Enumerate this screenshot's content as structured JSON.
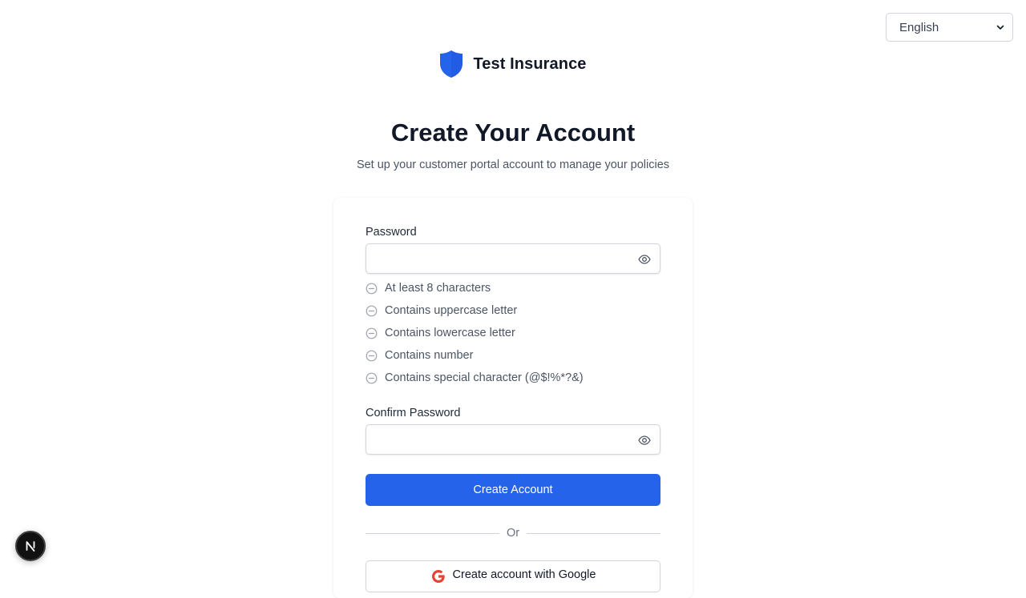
{
  "language_select": {
    "value": "English"
  },
  "brand": {
    "name": "Test Insurance",
    "color": "#2563eb"
  },
  "header": {
    "title": "Create Your Account",
    "subtitle": "Set up your customer portal account to manage your policies"
  },
  "form": {
    "password_label": "Password",
    "password_value": "",
    "requirements": [
      "At least 8 characters",
      "Contains uppercase letter",
      "Contains lowercase letter",
      "Contains number",
      "Contains special character (@$!%*?&)"
    ],
    "confirm_label": "Confirm Password",
    "confirm_value": "",
    "submit_label": "Create Account",
    "divider_text": "Or",
    "google_label": "Create account with Google"
  },
  "colors": {
    "primary": "#2563eb",
    "text": "#111827",
    "muted": "#4b5563"
  },
  "icons": {
    "brand": "shield-icon",
    "toggle_visibility": "eye-icon",
    "requirement_status": "minus-circle-icon",
    "google": "google-icon",
    "dev_badge": "nextjs-logo-icon"
  }
}
